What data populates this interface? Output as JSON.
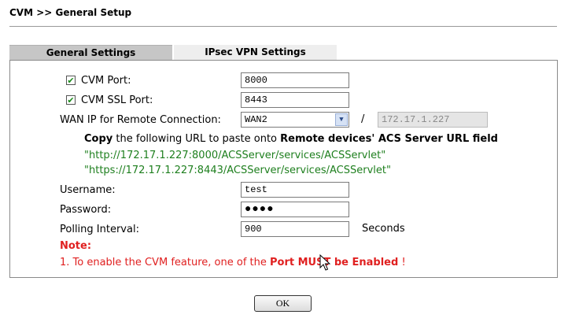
{
  "breadcrumb": "CVM >> General Setup",
  "tabs": [
    {
      "label": "General Settings",
      "active": true
    },
    {
      "label": "IPsec VPN Settings",
      "active": false
    }
  ],
  "form": {
    "cvm_port": {
      "label": "CVM Port:",
      "checked": true,
      "value": "8000"
    },
    "cvm_ssl_port": {
      "label": "CVM SSL Port:",
      "checked": true,
      "value": "8443"
    },
    "wan_ip": {
      "label": "WAN IP for Remote Connection:",
      "selected": "WAN2",
      "separator": "/",
      "ip_value": "172.17.1.227"
    },
    "copy_text": {
      "prefix": "Copy",
      "middle": " the following URL to paste onto ",
      "suffix": "Remote devices' ACS Server URL field"
    },
    "urls": [
      "\"http://172.17.1.227:8000/ACSServer/services/ACSServlet\"",
      "\"https://172.17.1.227:8443/ACSServer/services/ACSServlet\""
    ],
    "username": {
      "label": "Username:",
      "value": "test"
    },
    "password": {
      "label": "Password:",
      "value": "●●●●"
    },
    "polling_interval": {
      "label": "Polling Interval:",
      "value": "900",
      "unit": "Seconds"
    }
  },
  "note": {
    "title": "Note:",
    "line_prefix": "1. To enable the CVM feature, one of the ",
    "line_bold": "Port MUST be Enabled",
    "line_suffix": " !"
  },
  "ok_label": "OK",
  "icons": {
    "checkbox": "checkmark-icon",
    "dropdown": "chevron-down-icon",
    "cursor": "mouse-pointer-icon"
  }
}
